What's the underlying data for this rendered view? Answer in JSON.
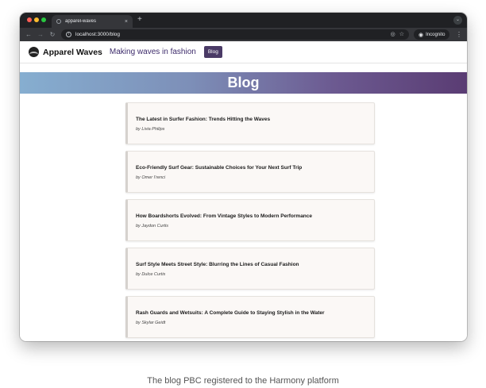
{
  "browser": {
    "tab_title": "apparel-waves",
    "tab_close": "×",
    "new_tab": "+",
    "url": "localhost:3000/blog",
    "incognito_label": "Incognito",
    "icons": [
      "back-arrow-icon",
      "forward-arrow-icon",
      "reload-icon",
      "site-info-icon",
      "eye-off-icon",
      "star-icon",
      "incognito-icon",
      "menu-icon"
    ]
  },
  "site": {
    "brand": "Apparel Waves",
    "tagline": "Making waves in fashion",
    "nav_blog": "Blog",
    "accent_color": "#4a3a66"
  },
  "hero": {
    "title": "Blog"
  },
  "posts": [
    {
      "title": "The Latest in Surfer Fashion: Trends Hitting the Waves",
      "author": "by Livia Philips"
    },
    {
      "title": "Eco-Friendly Surf Gear: Sustainable Choices for Your Next Surf Trip",
      "author": "by Omer I'renci"
    },
    {
      "title": "How Boardshorts Evolved: From Vintage Styles to Modern Performance",
      "author": "by Jaydon Curtis"
    },
    {
      "title": "Surf Style Meets Street Style: Blurring the Lines of Casual Fashion",
      "author": "by Dulce Curtis"
    },
    {
      "title": "Rash Guards and Wetsuits: A Complete Guide to Staying Stylish in the Water",
      "author": "by Skylar Geidt"
    }
  ],
  "caption": "The blog PBC registered to the Harmony platform"
}
